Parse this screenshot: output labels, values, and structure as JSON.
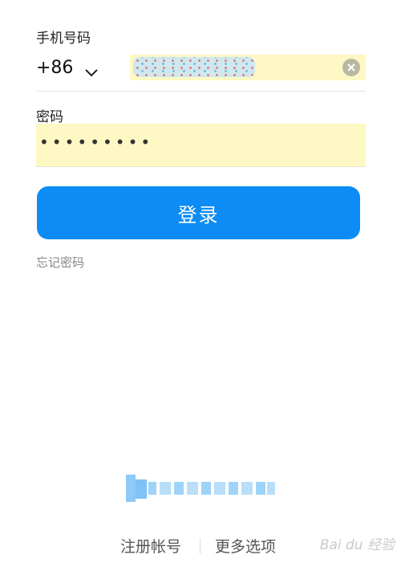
{
  "phone": {
    "label": "手机号码",
    "country_code": "+86",
    "clear_icon": "close-icon",
    "dropdown_icon": "chevron-down-icon"
  },
  "password": {
    "label": "密码",
    "value": "•••••••••"
  },
  "login": {
    "label": "登录"
  },
  "forgot": {
    "label": "忘记密码"
  },
  "footer": {
    "register": "注册帐号",
    "more_options": "更多选项"
  },
  "watermark": {
    "text": "Bai du 经验"
  },
  "colors": {
    "primary": "#0c8cf4",
    "autofill": "#fdf8c4"
  }
}
